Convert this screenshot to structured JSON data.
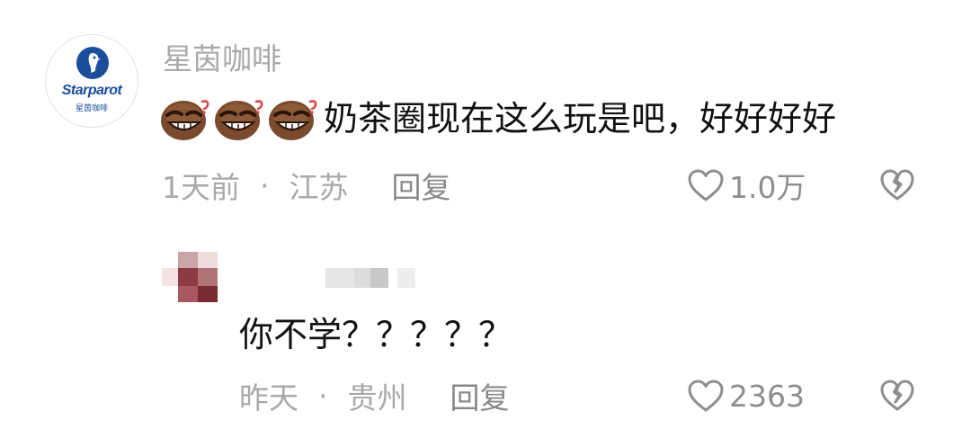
{
  "main_comment": {
    "avatar": {
      "brand_text": "Starparot",
      "brand_sub": "星茵咖啡",
      "brand_color": "#1b4d9b"
    },
    "username": "星茵咖啡",
    "emojis": [
      "grinning-brown-face-emoji",
      "grinning-brown-face-emoji",
      "grinning-brown-face-emoji"
    ],
    "text": "奶茶圈现在这么玩是吧，好好好好",
    "time": "1天前",
    "separator": "·",
    "location": "江苏",
    "reply_label": "回复",
    "like_count": "1.0万"
  },
  "reply_comment": {
    "text": "你不学？？？？？",
    "time": "昨天",
    "separator": "·",
    "location": "贵州",
    "reply_label": "回复",
    "like_count": "2363"
  },
  "icons": {
    "like": "heart-outline-icon",
    "dislike": "broken-heart-icon"
  },
  "colors": {
    "text_primary": "#111111",
    "text_secondary": "#a9a9a9",
    "icon_gray": "#8e8e8e"
  }
}
